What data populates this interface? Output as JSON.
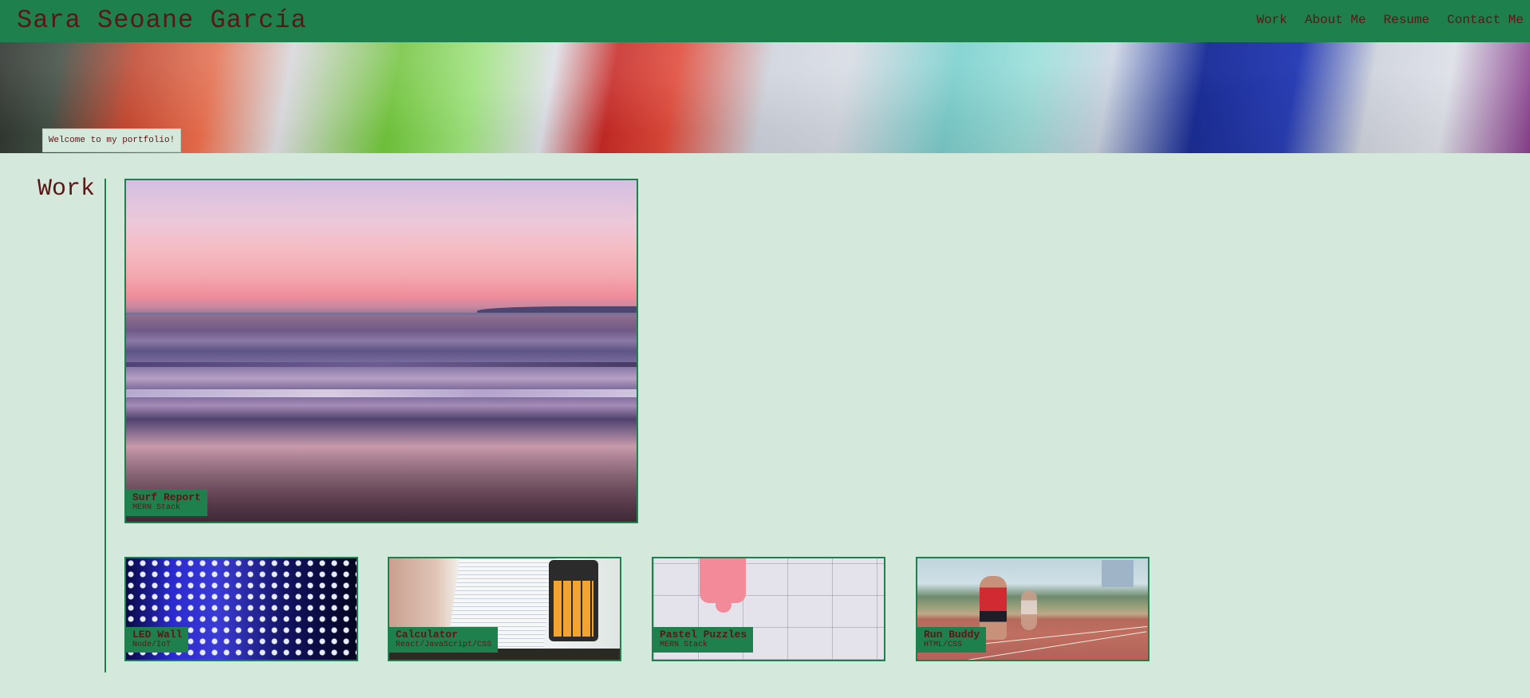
{
  "header": {
    "title": "Sara Seoane García",
    "nav": [
      {
        "label": "Work"
      },
      {
        "label": "About Me"
      },
      {
        "label": "Resume"
      },
      {
        "label": "Contact Me"
      }
    ]
  },
  "hero": {
    "welcome": "Welcome to my portfolio!"
  },
  "work": {
    "title": "Work",
    "featured": {
      "title": "Surf Report",
      "subtitle": "MERN Stack"
    },
    "projects": [
      {
        "title": "LED Wall",
        "subtitle": "Node/IoT"
      },
      {
        "title": "Calculator",
        "subtitle": "React/JavaScript/CSS"
      },
      {
        "title": "Pastel Puzzles",
        "subtitle": "MERN Stack"
      },
      {
        "title": "Run Buddy",
        "subtitle": "HTML/CSS"
      }
    ]
  },
  "colors": {
    "header_bg": "#1e804d",
    "page_bg": "#d4e8dc",
    "text": "#5b1616"
  }
}
